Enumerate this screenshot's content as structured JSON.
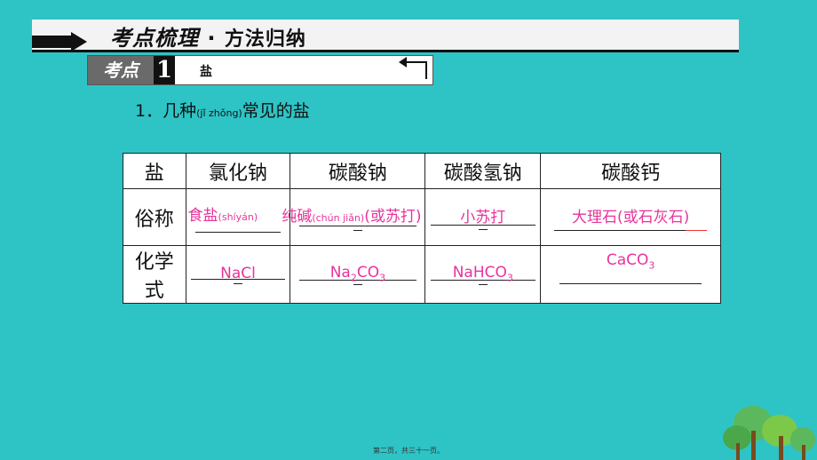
{
  "banner": {
    "title_part1": "考点梳理",
    "dot": "·",
    "title_part2": "方法归纳"
  },
  "point": {
    "label": "考点",
    "number": "1",
    "name": "盐"
  },
  "heading": {
    "prefix": "1．几种",
    "pinyin": "(jǐ zhǒng)",
    "suffix": "常见的盐"
  },
  "table": {
    "header": [
      "盐",
      "氯化钠",
      "碳酸钠",
      "碳酸氢钠",
      "碳酸钙"
    ],
    "row2_label": "俗称",
    "row3_label_line1": "化学",
    "row3_label_line2": "式",
    "common_names": {
      "nacl_main": "食盐",
      "nacl_py": "(shíyán)",
      "na2co3_main": "纯碱",
      "na2co3_py": "(chún jiǎn)",
      "na2co3_rest": "(或苏打)",
      "nahco3": "小苏打",
      "caco3": "大理石(或石灰石)"
    },
    "formulas": {
      "nacl": "NaCl",
      "na2co3_a": "Na",
      "na2co3_sub1": "2",
      "na2co3_b": "CO",
      "na2co3_sub2": "3",
      "nahco3_a": "NaHCO",
      "nahco3_sub": "3",
      "caco3_a": "CaCO",
      "caco3_sub": "3"
    }
  },
  "footer": "第二页，共三十一页。",
  "colors": {
    "background": "#2ec4c6",
    "answer": "#e8339c"
  }
}
